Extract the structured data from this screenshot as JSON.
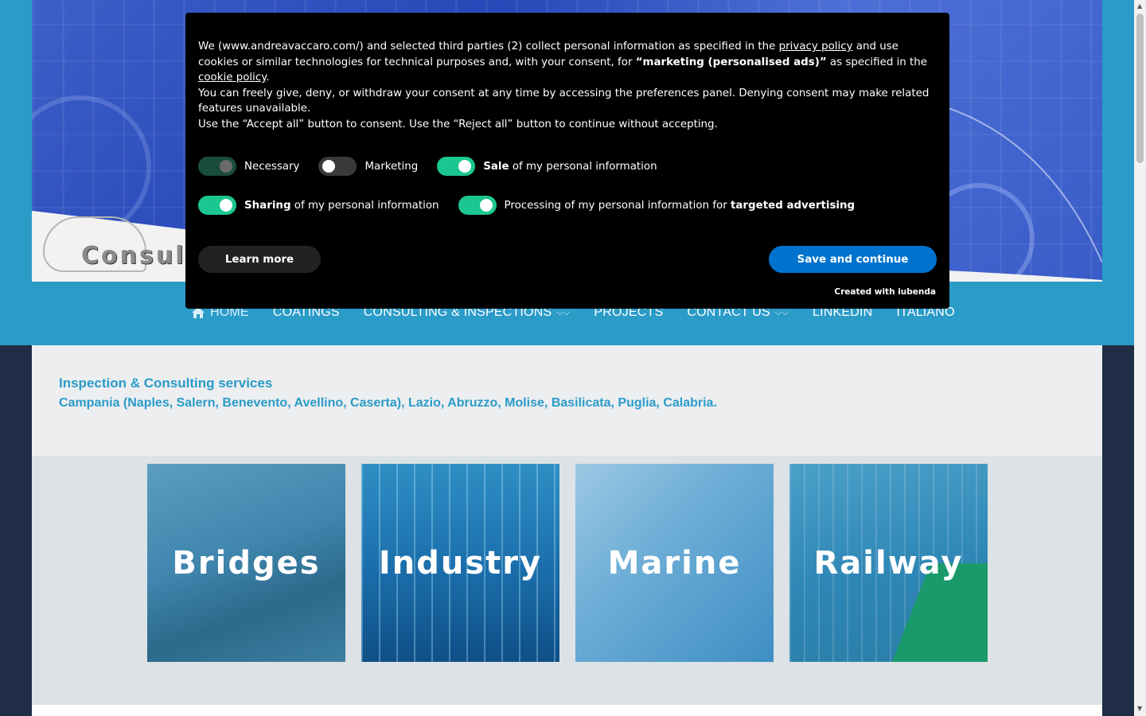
{
  "nav": {
    "items": [
      {
        "label": "HOME",
        "dropdown": false
      },
      {
        "label": "COATINGS",
        "dropdown": false
      },
      {
        "label": "CONSULTING & INSPECTIONS",
        "dropdown": true
      },
      {
        "label": "PROJECTS",
        "dropdown": false
      },
      {
        "label": "CONTACT US",
        "dropdown": true
      },
      {
        "label": "LINKEDIN",
        "dropdown": false
      },
      {
        "label": "ITALIANO",
        "dropdown": false
      }
    ]
  },
  "logo": {
    "text": "Consult"
  },
  "intro": {
    "title": "Inspection & Consulting services",
    "regions": "Campania (Naples, Salern, Benevento, Avellino, Caserta), Lazio, Abruzzo, Molise, Basilicata, Puglia, Calabria."
  },
  "tiles": [
    {
      "label": "Bridges"
    },
    {
      "label": "Industry"
    },
    {
      "label": "Marine"
    },
    {
      "label": "Railway"
    }
  ],
  "cookie": {
    "p1_a": "We (www.andreavaccaro.com/) and selected third parties (2) collect personal information as specified in the ",
    "privacy_link": "privacy policy",
    "p1_b": " and use cookies or similar technologies for technical purposes and, with your consent, for ",
    "marketing_bold": "“marketing (personalised ads)”",
    "p1_c": " as specified in the ",
    "cookie_link": "cookie policy",
    "p1_d": ".",
    "p2": "You can freely give, deny, or withdraw your consent at any time by accessing the preferences panel. Denying consent may make related features unavailable.",
    "p3": "Use the “Accept all” button to consent. Use the “Reject all” button to continue without accepting.",
    "toggles": {
      "necessary": "Necessary",
      "marketing": "Marketing",
      "sale_bold": "Sale",
      "sale_rest": " of my personal information",
      "sharing_bold": "Sharing",
      "sharing_rest": " of my personal information",
      "processing_rest": "Processing of my personal information for ",
      "processing_bold": "targeted advertising"
    },
    "learn_more": "Learn more",
    "save_continue": "Save and continue",
    "credit": "Created with iubenda"
  },
  "colors": {
    "accent": "#2b9bc8",
    "toggle_on": "#1cc691",
    "save_button": "#0073ce",
    "banner_bg": "#000000"
  }
}
